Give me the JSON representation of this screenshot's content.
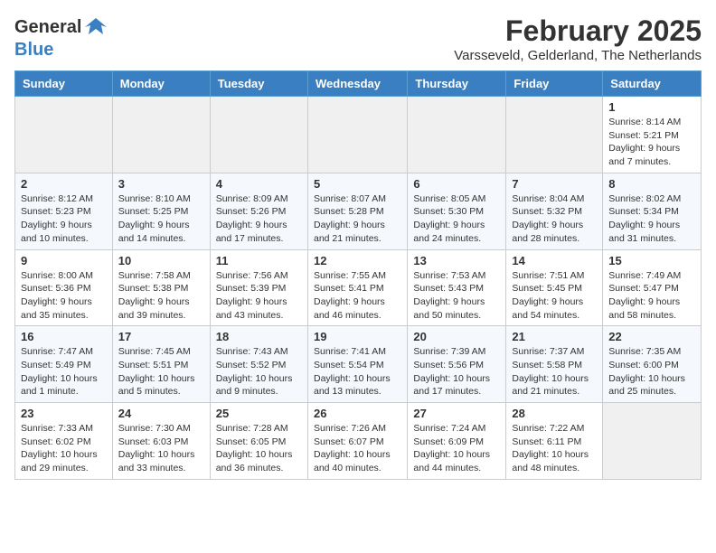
{
  "header": {
    "logo_general": "General",
    "logo_blue": "Blue",
    "month_year": "February 2025",
    "location": "Varsseveld, Gelderland, The Netherlands"
  },
  "columns": [
    "Sunday",
    "Monday",
    "Tuesday",
    "Wednesday",
    "Thursday",
    "Friday",
    "Saturday"
  ],
  "weeks": [
    [
      {
        "day": "",
        "info": ""
      },
      {
        "day": "",
        "info": ""
      },
      {
        "day": "",
        "info": ""
      },
      {
        "day": "",
        "info": ""
      },
      {
        "day": "",
        "info": ""
      },
      {
        "day": "",
        "info": ""
      },
      {
        "day": "1",
        "info": "Sunrise: 8:14 AM\nSunset: 5:21 PM\nDaylight: 9 hours and 7 minutes."
      }
    ],
    [
      {
        "day": "2",
        "info": "Sunrise: 8:12 AM\nSunset: 5:23 PM\nDaylight: 9 hours and 10 minutes."
      },
      {
        "day": "3",
        "info": "Sunrise: 8:10 AM\nSunset: 5:25 PM\nDaylight: 9 hours and 14 minutes."
      },
      {
        "day": "4",
        "info": "Sunrise: 8:09 AM\nSunset: 5:26 PM\nDaylight: 9 hours and 17 minutes."
      },
      {
        "day": "5",
        "info": "Sunrise: 8:07 AM\nSunset: 5:28 PM\nDaylight: 9 hours and 21 minutes."
      },
      {
        "day": "6",
        "info": "Sunrise: 8:05 AM\nSunset: 5:30 PM\nDaylight: 9 hours and 24 minutes."
      },
      {
        "day": "7",
        "info": "Sunrise: 8:04 AM\nSunset: 5:32 PM\nDaylight: 9 hours and 28 minutes."
      },
      {
        "day": "8",
        "info": "Sunrise: 8:02 AM\nSunset: 5:34 PM\nDaylight: 9 hours and 31 minutes."
      }
    ],
    [
      {
        "day": "9",
        "info": "Sunrise: 8:00 AM\nSunset: 5:36 PM\nDaylight: 9 hours and 35 minutes."
      },
      {
        "day": "10",
        "info": "Sunrise: 7:58 AM\nSunset: 5:38 PM\nDaylight: 9 hours and 39 minutes."
      },
      {
        "day": "11",
        "info": "Sunrise: 7:56 AM\nSunset: 5:39 PM\nDaylight: 9 hours and 43 minutes."
      },
      {
        "day": "12",
        "info": "Sunrise: 7:55 AM\nSunset: 5:41 PM\nDaylight: 9 hours and 46 minutes."
      },
      {
        "day": "13",
        "info": "Sunrise: 7:53 AM\nSunset: 5:43 PM\nDaylight: 9 hours and 50 minutes."
      },
      {
        "day": "14",
        "info": "Sunrise: 7:51 AM\nSunset: 5:45 PM\nDaylight: 9 hours and 54 minutes."
      },
      {
        "day": "15",
        "info": "Sunrise: 7:49 AM\nSunset: 5:47 PM\nDaylight: 9 hours and 58 minutes."
      }
    ],
    [
      {
        "day": "16",
        "info": "Sunrise: 7:47 AM\nSunset: 5:49 PM\nDaylight: 10 hours and 1 minute."
      },
      {
        "day": "17",
        "info": "Sunrise: 7:45 AM\nSunset: 5:51 PM\nDaylight: 10 hours and 5 minutes."
      },
      {
        "day": "18",
        "info": "Sunrise: 7:43 AM\nSunset: 5:52 PM\nDaylight: 10 hours and 9 minutes."
      },
      {
        "day": "19",
        "info": "Sunrise: 7:41 AM\nSunset: 5:54 PM\nDaylight: 10 hours and 13 minutes."
      },
      {
        "day": "20",
        "info": "Sunrise: 7:39 AM\nSunset: 5:56 PM\nDaylight: 10 hours and 17 minutes."
      },
      {
        "day": "21",
        "info": "Sunrise: 7:37 AM\nSunset: 5:58 PM\nDaylight: 10 hours and 21 minutes."
      },
      {
        "day": "22",
        "info": "Sunrise: 7:35 AM\nSunset: 6:00 PM\nDaylight: 10 hours and 25 minutes."
      }
    ],
    [
      {
        "day": "23",
        "info": "Sunrise: 7:33 AM\nSunset: 6:02 PM\nDaylight: 10 hours and 29 minutes."
      },
      {
        "day": "24",
        "info": "Sunrise: 7:30 AM\nSunset: 6:03 PM\nDaylight: 10 hours and 33 minutes."
      },
      {
        "day": "25",
        "info": "Sunrise: 7:28 AM\nSunset: 6:05 PM\nDaylight: 10 hours and 36 minutes."
      },
      {
        "day": "26",
        "info": "Sunrise: 7:26 AM\nSunset: 6:07 PM\nDaylight: 10 hours and 40 minutes."
      },
      {
        "day": "27",
        "info": "Sunrise: 7:24 AM\nSunset: 6:09 PM\nDaylight: 10 hours and 44 minutes."
      },
      {
        "day": "28",
        "info": "Sunrise: 7:22 AM\nSunset: 6:11 PM\nDaylight: 10 hours and 48 minutes."
      },
      {
        "day": "",
        "info": ""
      }
    ]
  ]
}
